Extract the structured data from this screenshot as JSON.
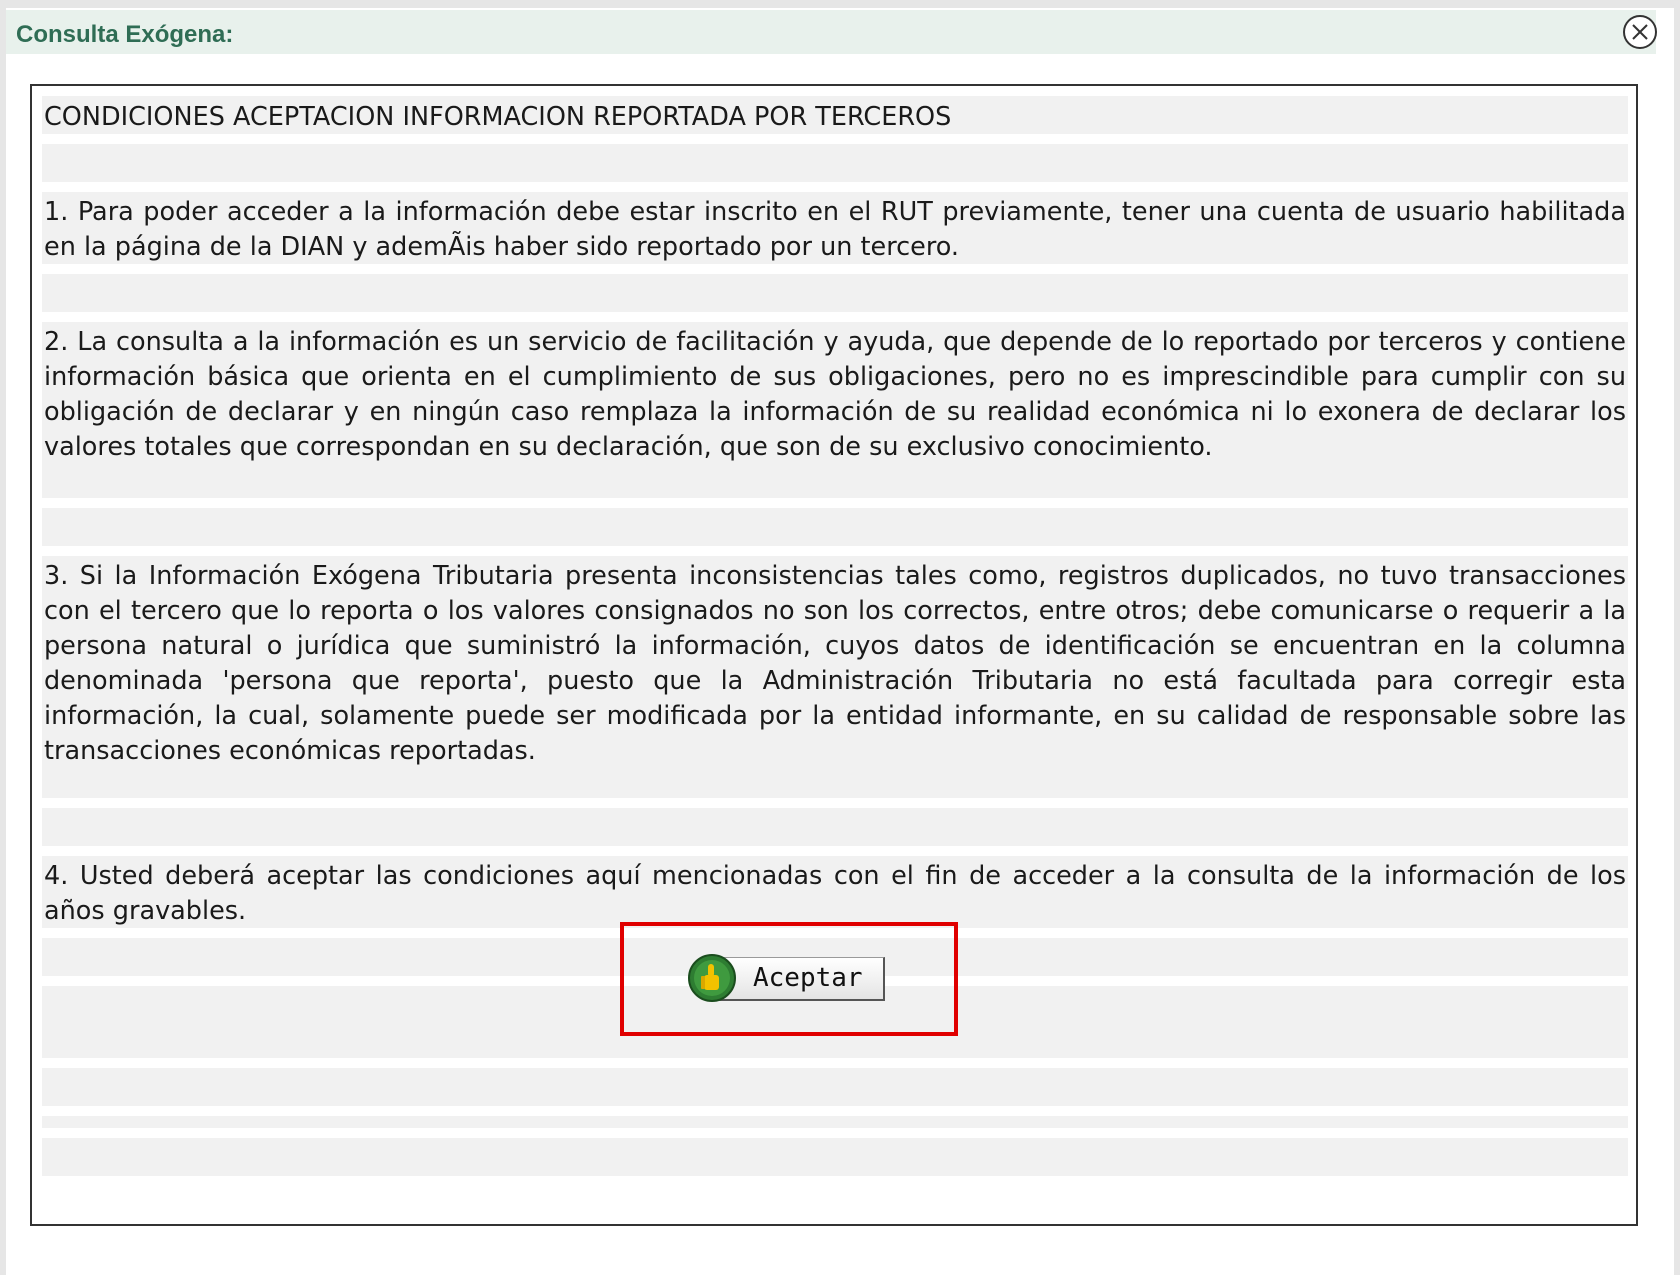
{
  "dialog": {
    "title": "Consulta Exógena:",
    "close_icon": "close-circle-icon"
  },
  "content": {
    "heading": "CONDICIONES ACEPTACION INFORMACION REPORTADA POR TERCEROS",
    "items": [
      "1. Para poder acceder a la información debe estar inscrito en el RUT previamente, tener una cuenta de usuario habilitada en la página de la DIAN y ademÃis haber sido reportado por un tercero.",
      "2. La consulta a la información es un servicio de facilitación y ayuda, que depende de lo reportado por terceros y contiene información básica que orienta en el cumplimiento de sus obligaciones, pero no es imprescindible para cumplir con su obligación de declarar y en ningún caso remplaza la información de su realidad económica ni lo exonera de declarar los valores totales que correspondan en su declaración, que son de su exclusivo conocimiento.",
      "3. Si la Información Exógena Tributaria presenta inconsistencias tales como, registros duplicados, no tuvo transacciones con el tercero que lo reporta o los valores consignados no son los correctos, entre otros; debe comunicarse o requerir a la persona natural o jurídica que suministró la información, cuyos datos de identificación se encuentran en la columna denominada 'persona que reporta', puesto que la Administración Tributaria no está facultada para corregir esta información, la cual, solamente puede ser modificada por la entidad informante, en su calidad de responsable sobre las transacciones económicas reportadas.",
      "4. Usted deberá aceptar las condiciones aquí mencionadas con el fin de acceder a la consulta de la información de los años gravables."
    ]
  },
  "accept_button": {
    "label": "Aceptar",
    "icon": "thumbs-up-icon"
  },
  "colors": {
    "title_bar_bg": "#e8f1ec",
    "title_text": "#2f6d55",
    "row_bg": "#f1f1f1",
    "highlight_border": "#e00000",
    "icon_green": "#2e7d32",
    "icon_yellow": "#f2c200"
  }
}
